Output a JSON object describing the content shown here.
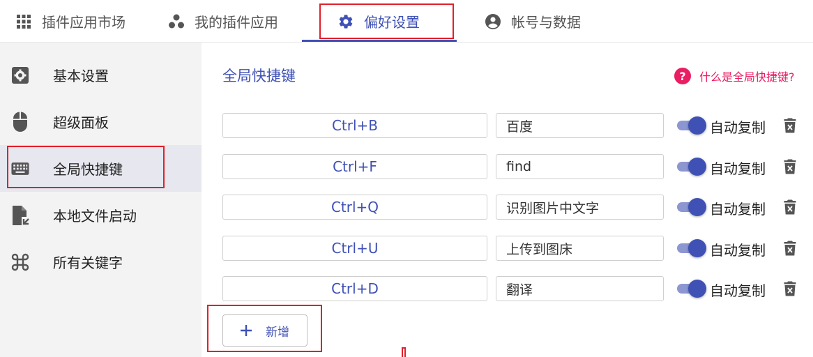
{
  "tabs": [
    {
      "label": "插件应用市场",
      "icon": "apps-grid-icon"
    },
    {
      "label": "我的插件应用",
      "icon": "bubbles-icon"
    },
    {
      "label": "偏好设置",
      "icon": "gear-icon",
      "active": true
    },
    {
      "label": "帐号与数据",
      "icon": "account-icon"
    }
  ],
  "sidebar": {
    "items": [
      {
        "label": "基本设置",
        "icon": "settings-box-icon"
      },
      {
        "label": "超级面板",
        "icon": "mouse-icon"
      },
      {
        "label": "全局快捷键",
        "icon": "keyboard-icon",
        "selected": true
      },
      {
        "label": "本地文件启动",
        "icon": "file-launch-icon"
      },
      {
        "label": "所有关键字",
        "icon": "command-key-icon"
      }
    ]
  },
  "main": {
    "title": "全局快捷键",
    "help_text": "什么是全局快捷键?",
    "help_symbol": "?",
    "toggle_label": "自动复制",
    "shortcuts": [
      {
        "key": "Ctrl+B",
        "value": "百度",
        "auto_copy": true
      },
      {
        "key": "Ctrl+F",
        "value": "find",
        "auto_copy": true
      },
      {
        "key": "Ctrl+Q",
        "value": "识别图片中文字",
        "auto_copy": true
      },
      {
        "key": "Ctrl+U",
        "value": "上传到图床",
        "auto_copy": true
      },
      {
        "key": "Ctrl+D",
        "value": "翻译",
        "auto_copy": true
      }
    ],
    "add_button_label": "新增"
  },
  "colors": {
    "accent": "#3f51b5",
    "help": "#e91e63",
    "annotation": "#e0202a",
    "sidebar_bg": "#f3f3f3",
    "sidebar_selected": "#e6e7ef"
  }
}
